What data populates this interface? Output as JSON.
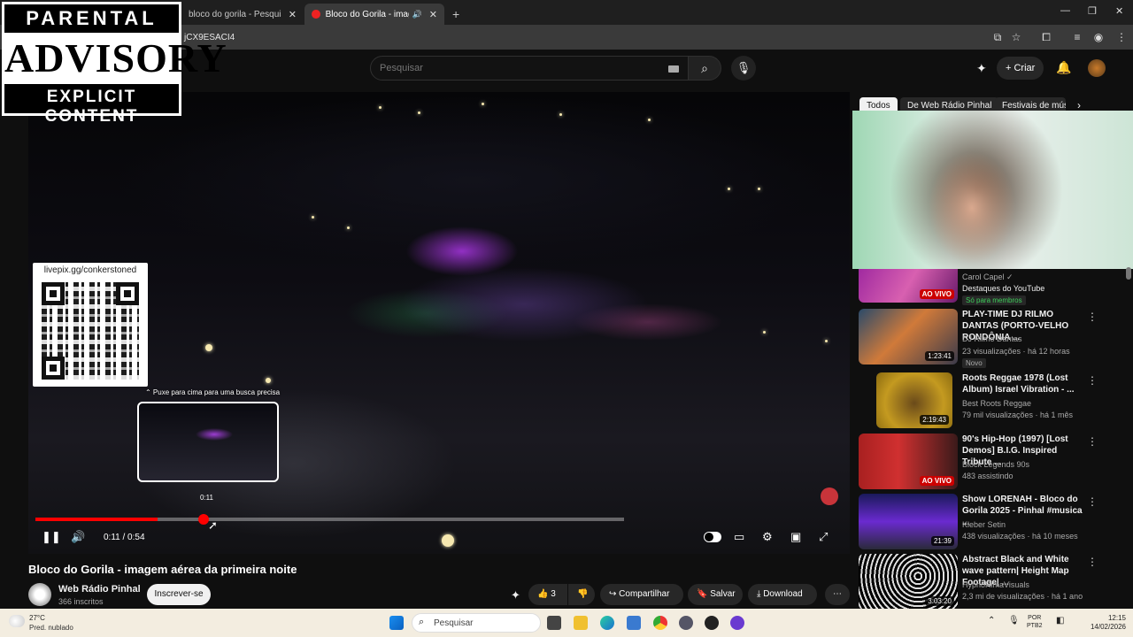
{
  "browser": {
    "tabs": [
      {
        "label": "bloco do gorila - Pesquisa Goo",
        "close": "✕"
      },
      {
        "label": "Bloco do Gorila - imagem a",
        "close": "✕"
      }
    ],
    "new_tab": "+",
    "url": "jCX9ESACI4",
    "window_controls": {
      "minimize": "—",
      "restore": "❐",
      "close": "✕"
    }
  },
  "youtube": {
    "search_placeholder": "Pesquisar",
    "create_label": "+ Criar",
    "chips": [
      "Todos",
      "De Web Rádio Pinhal",
      "Festivais de mús"
    ]
  },
  "overlay": {
    "parental_top": "PARENTAL",
    "parental_mid": "ADVISORY",
    "parental_bottom": "EXPLICIT CONTENT",
    "qr_label": "livepix.gg/conkerstoned"
  },
  "player": {
    "pull_hint": "⌃ Puxe para cima para uma busca precisa",
    "preview_time": "0:11",
    "time_display": "0:11 / 0:54",
    "progress_fraction": 0.207,
    "buffer_fraction": 1.0
  },
  "video": {
    "title": "Bloco do Gorila - imagem aérea da primeira noite",
    "channel": "Web Rádio Pinhal",
    "subscribers": "366 inscritos",
    "subscribe": "Inscrever-se",
    "likes": "3",
    "share": "Compartilhar",
    "save": "Salvar",
    "download": "Download"
  },
  "sidebar": {
    "items": [
      {
        "title": "",
        "channel": "Carol Capel ✓",
        "meta": "Destaques do YouTube",
        "badge": "Só para membros",
        "duration": "AO VIVO",
        "live": true
      },
      {
        "title": "PLAY-TIME DJ RILMO DANTAS (PORTO-VELHO RONDÔNIA ...",
        "channel": "DJ Rilmo Dantas",
        "meta": "23 visualizações · há 12 horas",
        "badge": "Novo",
        "duration": "1:23:41",
        "live": false
      },
      {
        "title": "Roots Reggae 1978 (Lost Album) Israel Vibration - ...",
        "channel": "Best Roots Reggae",
        "meta": "79 mil visualizações · há 1 mês",
        "badge": "",
        "duration": "2:19:43",
        "live": false
      },
      {
        "title": "90's Hip-Hop (1997) [Lost Demos] B.I.G. Inspired Tribute ...",
        "channel": "Block Legends 90s",
        "meta": "483 assistindo",
        "badge": "",
        "duration": "AO VIVO",
        "live": true
      },
      {
        "title": "Show LORENAH - Bloco do Gorila 2025 - Pinhal #musica ...",
        "channel": "Kleber Setin",
        "meta": "438 visualizações · há 10 meses",
        "badge": "",
        "duration": "21:39",
        "live": false
      },
      {
        "title": "Abstract Black and White wave pattern| Height Map Footage| ...",
        "channel": "HypnoRimaVisuals",
        "meta": "2,3 mi de visualizações · há 1 ano",
        "badge": "",
        "duration": "3:03:20",
        "live": false
      }
    ]
  },
  "taskbar": {
    "weather_temp": "27°C",
    "weather_desc": "Pred. nublado",
    "search": "Pesquisar",
    "lang_1": "POR",
    "lang_2": "PTB2",
    "time": "12:15",
    "date": "14/02/2026"
  }
}
